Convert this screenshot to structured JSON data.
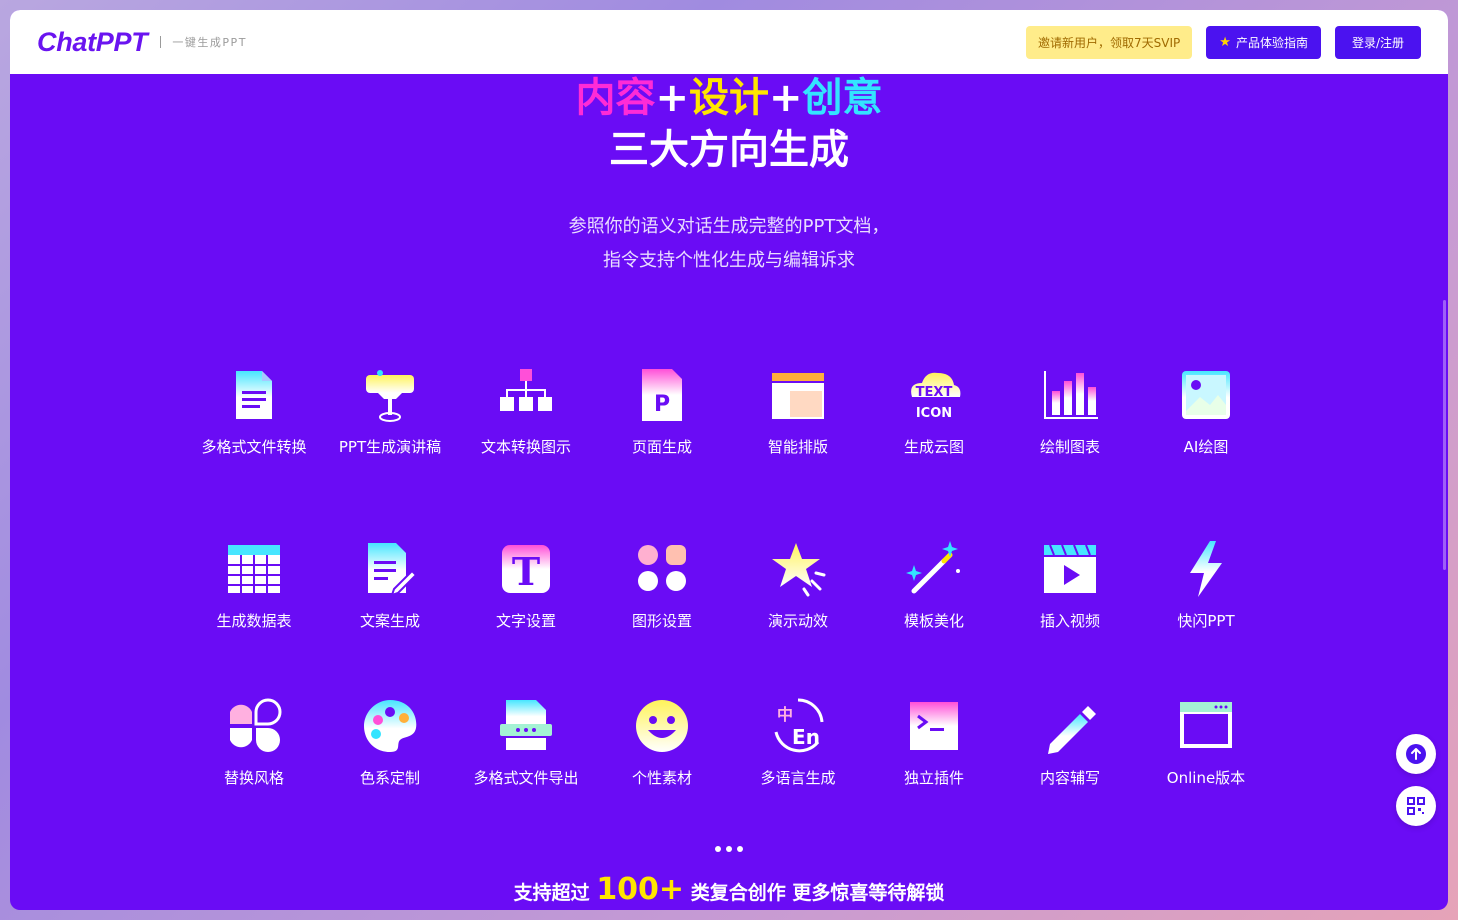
{
  "header": {
    "logo": "ChatPPT",
    "slogan": "一键生成PPT",
    "invite_label": "邀请新用户，领取7天SVIP",
    "guide_label": "产品体验指南",
    "login_label": "登录/注册"
  },
  "hero": {
    "part1": "内容",
    "plus1": "+",
    "part2": "设计",
    "plus2": "+",
    "part3": "创意",
    "line2": "三大方向生成",
    "desc1": "参照你的语义对话生成完整的PPT文档，",
    "desc2": "指令支持个性化生成与编辑诉求"
  },
  "features": [
    {
      "label": "多格式文件转换",
      "icon": "document-icon"
    },
    {
      "label": "PPT生成演讲稿",
      "icon": "podium-icon"
    },
    {
      "label": "文本转换图示",
      "icon": "hierarchy-icon"
    },
    {
      "label": "页面生成",
      "icon": "ppt-file-icon"
    },
    {
      "label": "智能排版",
      "icon": "layout-icon"
    },
    {
      "label": "生成云图",
      "icon": "word-cloud-icon",
      "icon_text1": "TEXT",
      "icon_text2": "ICON"
    },
    {
      "label": "绘制图表",
      "icon": "bar-chart-icon"
    },
    {
      "label": "AI绘图",
      "icon": "image-icon"
    },
    {
      "label": "生成数据表",
      "icon": "table-icon"
    },
    {
      "label": "文案生成",
      "icon": "edit-doc-icon"
    },
    {
      "label": "文字设置",
      "icon": "text-t-icon",
      "icon_text1": "T"
    },
    {
      "label": "图形设置",
      "icon": "shapes-icon"
    },
    {
      "label": "演示动效",
      "icon": "star-icon"
    },
    {
      "label": "模板美化",
      "icon": "magic-wand-icon"
    },
    {
      "label": "插入视频",
      "icon": "video-icon"
    },
    {
      "label": "快闪PPT",
      "icon": "lightning-icon"
    },
    {
      "label": "替换风格",
      "icon": "petals-icon"
    },
    {
      "label": "色系定制",
      "icon": "palette-icon"
    },
    {
      "label": "多格式文件导出",
      "icon": "export-file-icon"
    },
    {
      "label": "个性素材",
      "icon": "smiley-icon"
    },
    {
      "label": "多语言生成",
      "icon": "translate-icon",
      "icon_text1": "中",
      "icon_text2": "En"
    },
    {
      "label": "独立插件",
      "icon": "terminal-icon"
    },
    {
      "label": "内容辅写",
      "icon": "pencil-icon"
    },
    {
      "label": "Online版本",
      "icon": "browser-icon"
    }
  ],
  "bottom": {
    "prefix": "支持超过",
    "number": "100+",
    "suffix": "类复合创作 更多惊喜等待解锁"
  },
  "float_buttons": {
    "top_icon": "arrow-up-icon",
    "qr_icon": "qr-code-icon"
  },
  "colors": {
    "background": "#6a0cf5",
    "accent_pink": "#ff2bd6",
    "accent_yellow": "#ffe500",
    "accent_cyan": "#33e4ff"
  }
}
